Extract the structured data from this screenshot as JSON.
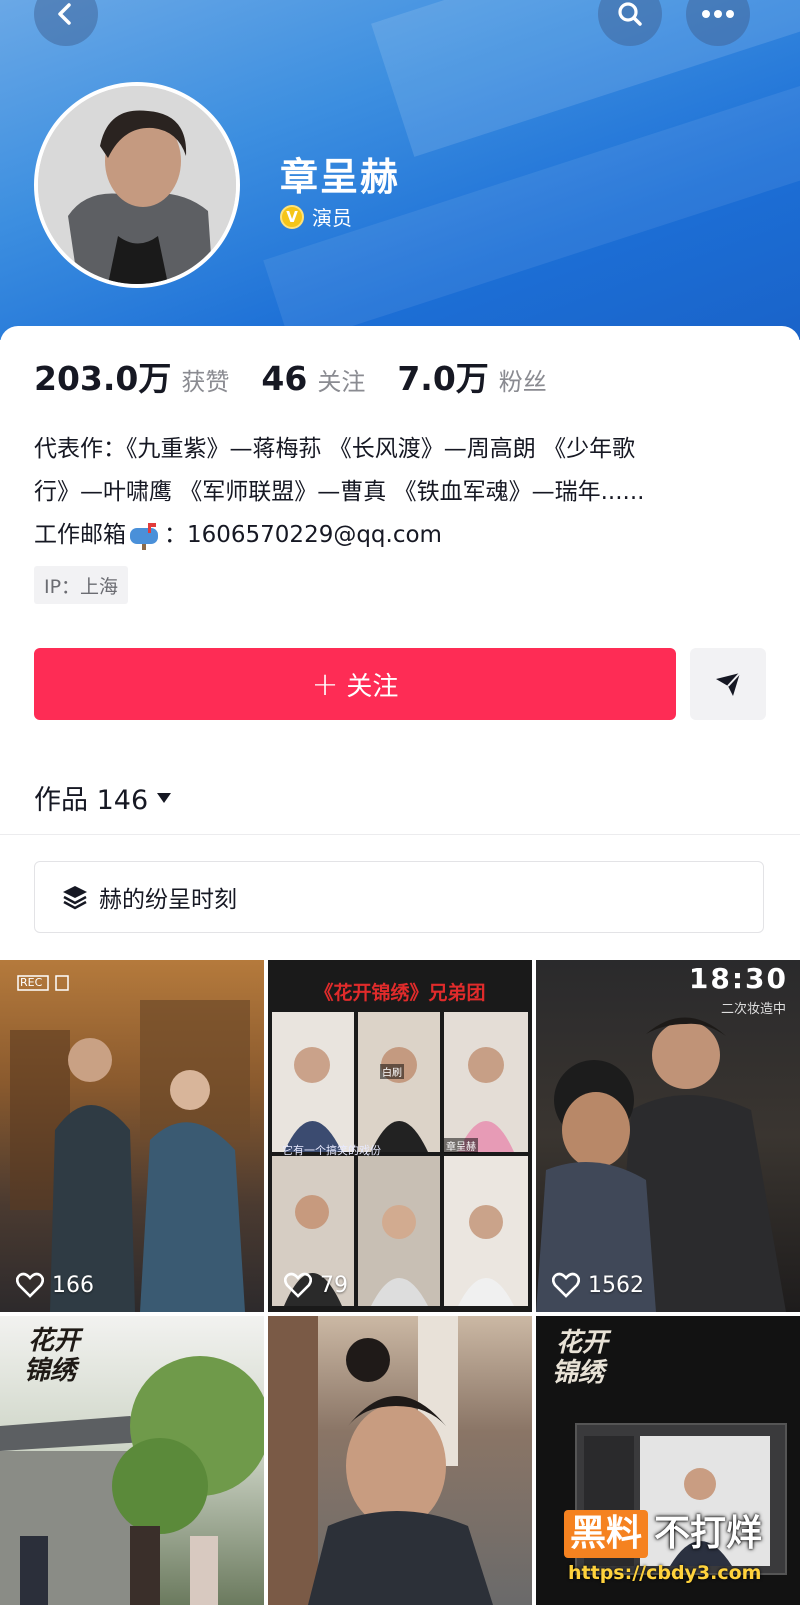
{
  "profile": {
    "name": "章呈赫",
    "verified_badge": "V",
    "title": "演员"
  },
  "stats": {
    "likes_value": "203.0万",
    "likes_label": "获赞",
    "following_value": "46",
    "following_label": "关注",
    "followers_value": "7.0万",
    "followers_label": "粉丝"
  },
  "bio": {
    "line1": "代表作：《九重紫》—蒋梅荪 《长风渡》—周高朗 《少年歌",
    "line2": "行》—叶啸鹰 《军师联盟》—曹真 《铁血军魂》—瑞年......",
    "line3_prefix": "工作邮箱",
    "line3_suffix": "：1606570229@qq.com",
    "ip": "IP：上海"
  },
  "actions": {
    "follow_plus": "+",
    "follow_label": "关注"
  },
  "works": {
    "label": "作品 146"
  },
  "collection": {
    "label": "赫的纷呈时刻"
  },
  "videos": [
    {
      "likes": "166",
      "overlay_rec": "REC"
    },
    {
      "likes": "79",
      "overlay_title": "《花开锦绣》兄弟团",
      "overlay_caption": "它有一个搞笑的戏份",
      "overlay_name_a": "白刷",
      "overlay_name_b": "章呈赫"
    },
    {
      "likes": "1562",
      "overlay_time": "18:30",
      "overlay_sub": "二次妆造中"
    },
    {
      "likes": "",
      "overlay_logo_a": "花开",
      "overlay_logo_b": "锦绣"
    },
    {
      "likes": ""
    },
    {
      "likes": "",
      "overlay_logo_a": "花开",
      "overlay_logo_b": "锦绣"
    }
  ],
  "watermark": {
    "main_a": "黑料",
    "main_b": "不打烊",
    "url": "https://cbdy3.com"
  },
  "colors": {
    "accent": "#fe2c55",
    "header_blue": "#1c6fd6",
    "muted": "#8a8b91",
    "badge_gold": "#f5c518"
  }
}
